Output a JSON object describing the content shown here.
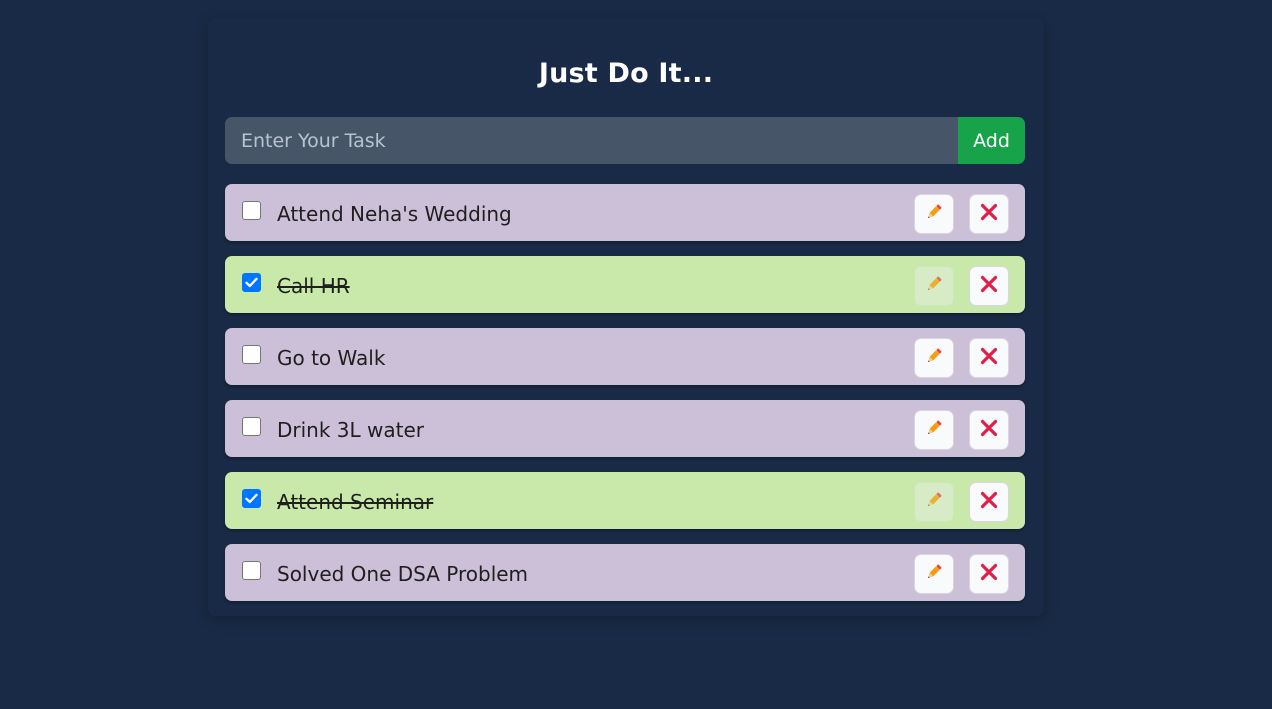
{
  "app": {
    "title": "Just Do It..."
  },
  "input": {
    "placeholder": "Enter Your Task",
    "value": "",
    "add_label": "Add"
  },
  "tasks": [
    {
      "text": "Attend Neha's Wedding",
      "completed": false
    },
    {
      "text": "Call HR",
      "completed": true
    },
    {
      "text": "Go to Walk",
      "completed": false
    },
    {
      "text": "Drink 3L water",
      "completed": false
    },
    {
      "text": "Attend Seminar",
      "completed": true
    },
    {
      "text": "Solved One DSA Problem",
      "completed": false
    }
  ],
  "icons": {
    "edit": "pencil-icon",
    "delete": "close-icon"
  },
  "colors": {
    "background": "#182a45",
    "pending_task": "#ccbfd8",
    "completed_task": "#c8e9a9",
    "add_button": "#16a34a",
    "input_background": "#475569",
    "checkbox_checked": "#0075ff",
    "delete_icon": "#e11d48",
    "edit_icon": "#f97316"
  }
}
